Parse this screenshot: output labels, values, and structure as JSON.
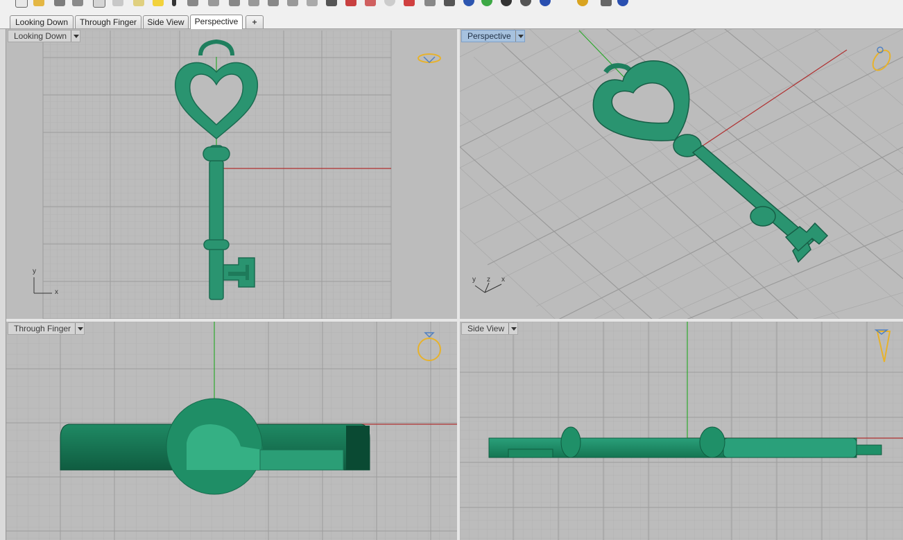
{
  "toolbar": {
    "icons": [
      "new-icon",
      "open-icon",
      "save-icon",
      "print-icon",
      "copy-icon",
      "cut-icon",
      "paste-icon",
      "undo-icon",
      "select-icon",
      "pan-icon",
      "rotate-icon",
      "zoom-icon",
      "zoom-window-icon",
      "zoom-extents-icon",
      "viewport-icon",
      "render-icon",
      "material-icon",
      "sphere-icon",
      "light-icon",
      "object-icon",
      "color-wheel-icon",
      "display-icon",
      "sphere-shaded-icon",
      "sphere-render-icon",
      "gear-icon",
      "camera-icon",
      "help-icon"
    ]
  },
  "tabs": [
    {
      "label": "Looking Down"
    },
    {
      "label": "Through Finger"
    },
    {
      "label": "Side View"
    },
    {
      "label": "Perspective",
      "active": true
    },
    {
      "label": "+"
    }
  ],
  "viewports": {
    "looking_down": {
      "title": "Looking Down",
      "axis_x": "x",
      "axis_y": "y"
    },
    "perspective": {
      "title": "Perspective",
      "axis_x": "x",
      "axis_y": "y",
      "axis_z": "z"
    },
    "through_finger": {
      "title": "Through Finger"
    },
    "side_view": {
      "title": "Side View"
    }
  },
  "colors": {
    "viewport_bg": "#bcbcbc",
    "grid": "#adadad",
    "grid_major": "#9a9a9a",
    "model": "#2a9470",
    "axis_x": "#b03030",
    "axis_y": "#2ea82e",
    "ring_gold": "#e7b22c"
  }
}
